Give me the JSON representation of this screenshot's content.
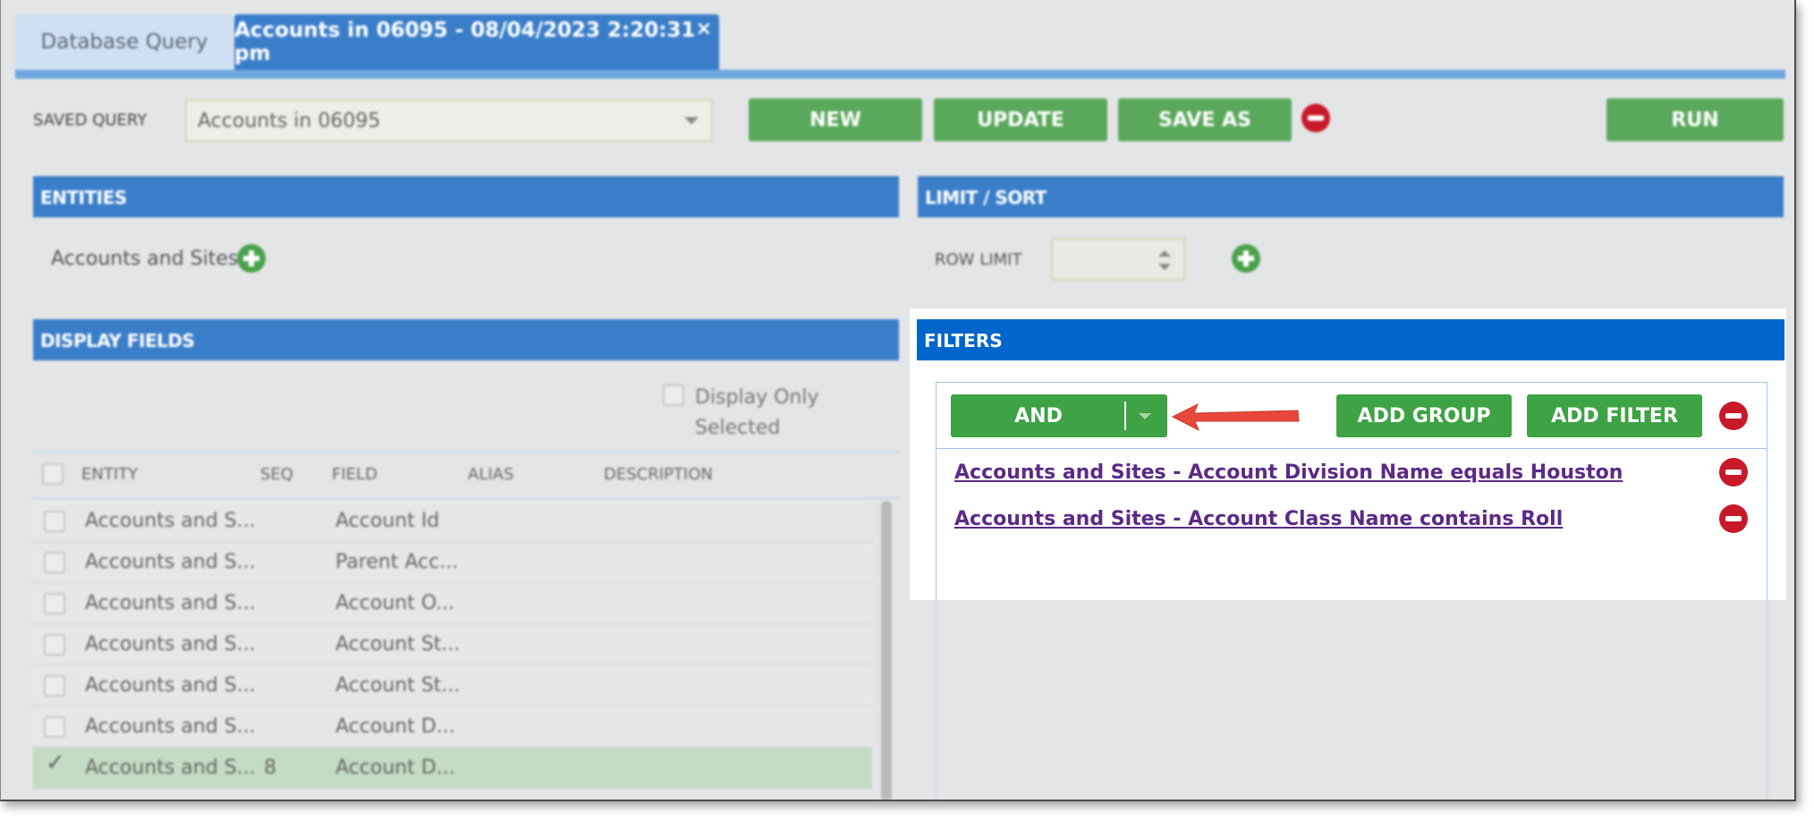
{
  "tabs": {
    "inactive_label": "Database Query",
    "active_label": "Accounts in 06095 - 08/04/2023 2:20:31 pm",
    "close_glyph": "×"
  },
  "saved_query": {
    "label": "SAVED QUERY",
    "value": "Accounts in 06095",
    "new_label": "NEW",
    "update_label": "UPDATE",
    "save_as_label": "SAVE AS",
    "run_label": "RUN"
  },
  "entities": {
    "title": "ENTITIES",
    "item": "Accounts and Sites"
  },
  "limit_sort": {
    "title": "LIMIT / SORT",
    "row_limit_label": "ROW LIMIT",
    "row_limit_value": ""
  },
  "display_fields": {
    "title": "DISPLAY FIELDS",
    "display_only_line1": "Display Only",
    "display_only_line2": "Selected",
    "columns": [
      "ENTITY",
      "SEQ",
      "FIELD",
      "ALIAS",
      "DESCRIPTION"
    ],
    "rows": [
      {
        "entity": "Accounts and S...",
        "seq": "",
        "field": "Account Id",
        "checked": false
      },
      {
        "entity": "Accounts and S...",
        "seq": "",
        "field": "Parent Acc...",
        "checked": false
      },
      {
        "entity": "Accounts and S...",
        "seq": "",
        "field": "Account O...",
        "checked": false
      },
      {
        "entity": "Accounts and S...",
        "seq": "",
        "field": "Account St...",
        "checked": false
      },
      {
        "entity": "Accounts and S...",
        "seq": "",
        "field": "Account St...",
        "checked": false
      },
      {
        "entity": "Accounts and S...",
        "seq": "",
        "field": "Account D...",
        "checked": false
      },
      {
        "entity": "Accounts and S...",
        "seq": "8",
        "field": "Account D...",
        "checked": true
      }
    ]
  },
  "filters": {
    "title": "FILTERS",
    "operator": "AND",
    "add_group_label": "ADD GROUP",
    "add_filter_label": "ADD FILTER",
    "items": [
      "Accounts and Sites - Account Division Name equals Houston",
      "Accounts and Sites - Account Class Name contains Roll"
    ]
  },
  "colors": {
    "header_blue": "#3a7ec9",
    "filters_blue": "#0066cc",
    "button_green": "#3da344",
    "remove_red": "#c8192a",
    "link_purple": "#5b2a86",
    "arrow_red": "#e8473b"
  }
}
